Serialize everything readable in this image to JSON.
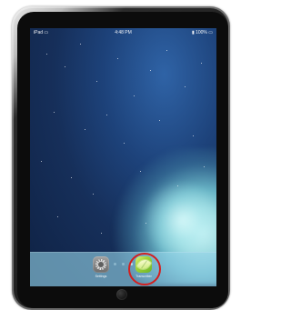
{
  "status_bar": {
    "carrier": "iPad ▭",
    "time": "4:48 PM",
    "battery": "▮ 100% ▭"
  },
  "home_screen": {
    "page_count": 3,
    "current_page": 3
  },
  "dock": {
    "apps": [
      {
        "label": "Settings",
        "icon": "settings-gear-icon"
      },
      {
        "label": "Transcriber",
        "icon": "leaf-app-icon",
        "highlighted": true
      }
    ]
  },
  "colors": {
    "highlight_ring": "#d31f1f",
    "dock_tint": "#93d2e6"
  }
}
